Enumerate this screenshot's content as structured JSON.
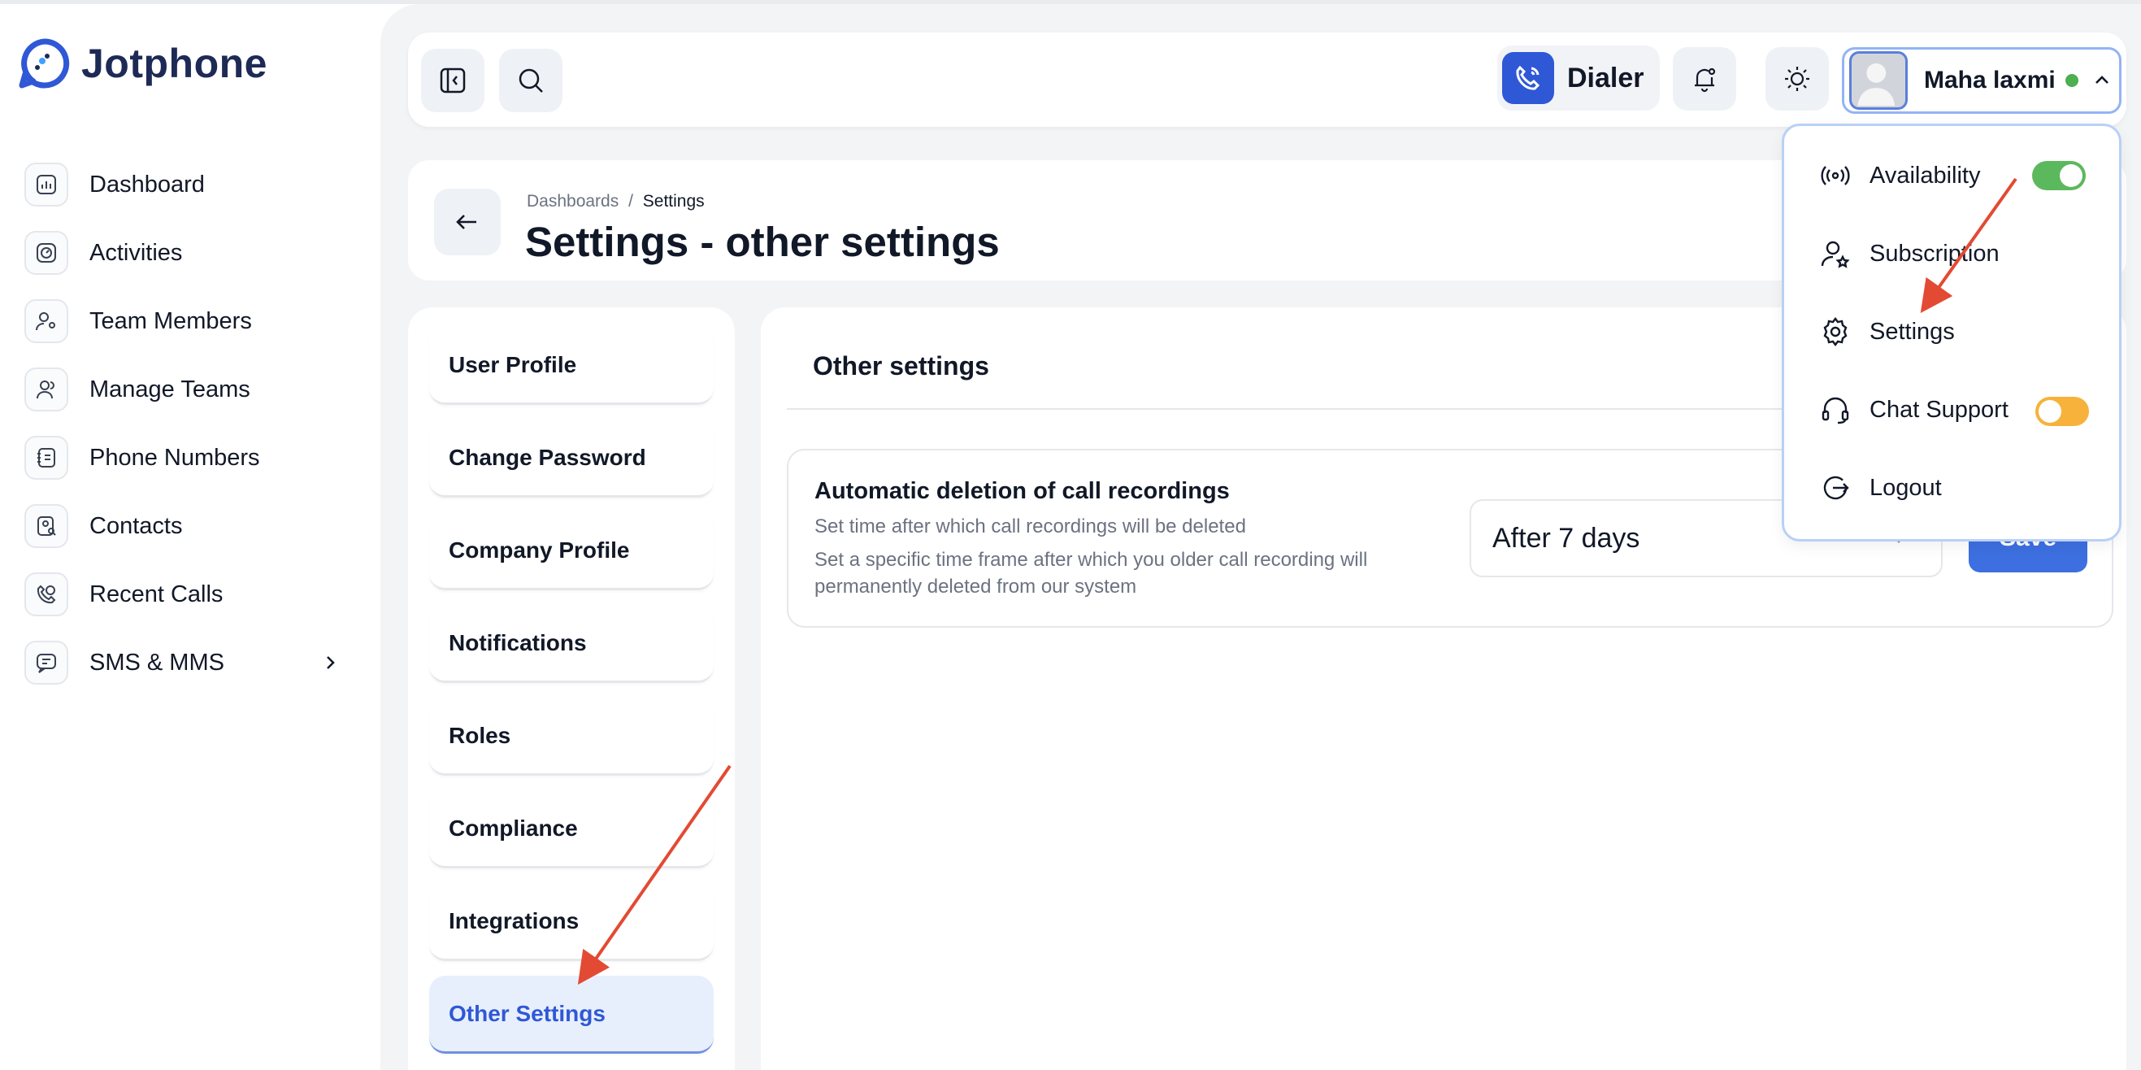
{
  "brand": {
    "name": "Jotphone"
  },
  "sidebar": {
    "items": [
      {
        "label": "Dashboard",
        "icon": "chart-icon"
      },
      {
        "label": "Activities",
        "icon": "activity-icon"
      },
      {
        "label": "Team Members",
        "icon": "user-gear-icon"
      },
      {
        "label": "Manage Teams",
        "icon": "users-icon"
      },
      {
        "label": "Phone Numbers",
        "icon": "phone-book-icon"
      },
      {
        "label": "Contacts",
        "icon": "contact-search-icon"
      },
      {
        "label": "Recent Calls",
        "icon": "phone-history-icon"
      },
      {
        "label": "SMS & MMS",
        "icon": "message-icon"
      }
    ]
  },
  "topbar": {
    "dialer_label": "Dialer",
    "user_name": "Maha laxmi",
    "status_color": "#4caf50"
  },
  "header": {
    "breadcrumb_root": "Dashboards",
    "breadcrumb_sep": "/",
    "breadcrumb_current": "Settings",
    "title": "Settings - other settings"
  },
  "settings_menu": {
    "items": [
      "User Profile",
      "Change Password",
      "Company Profile",
      "Notifications",
      "Roles",
      "Compliance",
      "Integrations",
      "Other Settings"
    ],
    "active": "Other Settings"
  },
  "content": {
    "title": "Other settings",
    "setting": {
      "title": "Automatic deletion of call recordings",
      "subtitle": "Set time after which call recordings will be deleted",
      "description": "Set a specific time frame after which you older call recording will permanently deleted from our system",
      "selected_value": "After 7 days",
      "save_label": "Save"
    }
  },
  "dropdown": {
    "availability": {
      "label": "Availability",
      "on": true
    },
    "subscription": {
      "label": "Subscription"
    },
    "settings": {
      "label": "Settings"
    },
    "chat_support": {
      "label": "Chat Support",
      "on": false
    },
    "logout": {
      "label": "Logout"
    }
  },
  "colors": {
    "accent": "#2f58d6",
    "toggle_green": "#5cb85c",
    "toggle_orange": "#f7b23b",
    "annotation_arrow": "#e34a33"
  }
}
